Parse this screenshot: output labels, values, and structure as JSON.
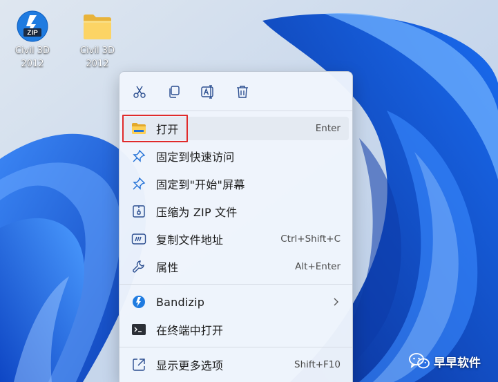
{
  "desktop": {
    "icons": [
      {
        "label": "Civil 3D\n2012",
        "badge": "ZIP",
        "icon": "bandizip-zip-icon"
      },
      {
        "label": "Civil 3D\n2012",
        "icon": "folder-icon"
      }
    ]
  },
  "context_menu": {
    "toolbar": [
      {
        "name": "cut",
        "icon": "scissors-icon"
      },
      {
        "name": "copy",
        "icon": "copy-icon"
      },
      {
        "name": "rename",
        "icon": "rename-icon"
      },
      {
        "name": "delete",
        "icon": "trash-icon"
      }
    ],
    "items": [
      {
        "label": "打开",
        "shortcut": "Enter",
        "icon": "folder-icon"
      },
      {
        "label": "固定到快速访问",
        "shortcut": "",
        "icon": "pin-icon"
      },
      {
        "label": "固定到\"开始\"屏幕",
        "shortcut": "",
        "icon": "pin-icon"
      },
      {
        "label": "压缩为 ZIP 文件",
        "shortcut": "",
        "icon": "zip-compress-icon"
      },
      {
        "label": "复制文件地址",
        "shortcut": "Ctrl+Shift+C",
        "icon": "copy-path-icon"
      },
      {
        "label": "属性",
        "shortcut": "Alt+Enter",
        "icon": "wrench-icon"
      },
      {
        "label": "Bandizip",
        "shortcut": "",
        "icon": "bandizip-icon",
        "has_submenu": true
      },
      {
        "label": "在终端中打开",
        "shortcut": "",
        "icon": "terminal-icon"
      },
      {
        "label": "显示更多选项",
        "shortcut": "Shift+F10",
        "icon": "more-options-icon"
      }
    ]
  },
  "watermark": {
    "text": "早早软件",
    "icon": "wechat-icon"
  },
  "colors": {
    "accent": "#0067c0",
    "highlight_box": "#e02a2a",
    "menu_bg": "#f0f5fc",
    "wallpaper_base": "#1e63e0"
  }
}
